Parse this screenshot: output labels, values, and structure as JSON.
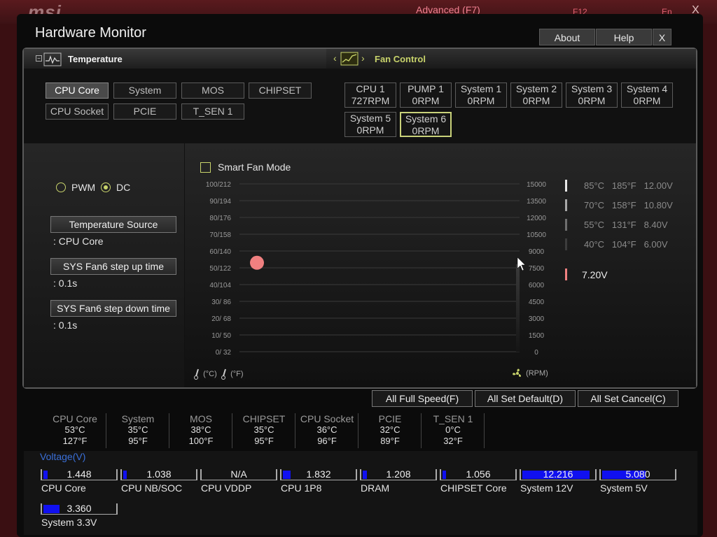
{
  "background": {
    "advanced_label": "Advanced (F7)",
    "f12_label": "F12",
    "lang_label": "En",
    "close": "X",
    "logo_text": "msi"
  },
  "window": {
    "title": "Hardware Monitor",
    "about": "About",
    "help": "Help",
    "close": "X"
  },
  "tabs": {
    "temperature": "Temperature",
    "fan_control": "Fan Control"
  },
  "temp_sources": [
    "CPU Core",
    "System",
    "MOS",
    "CHIPSET",
    "CPU Socket",
    "PCIE",
    "T_SEN 1"
  ],
  "fans": [
    {
      "name": "CPU 1",
      "rpm": "727RPM"
    },
    {
      "name": "PUMP 1",
      "rpm": "0RPM"
    },
    {
      "name": "System 1",
      "rpm": "0RPM"
    },
    {
      "name": "System 2",
      "rpm": "0RPM"
    },
    {
      "name": "System 3",
      "rpm": "0RPM"
    },
    {
      "name": "System 4",
      "rpm": "0RPM"
    },
    {
      "name": "System 5",
      "rpm": "0RPM"
    },
    {
      "name": "System 6",
      "rpm": "0RPM"
    }
  ],
  "selected_fan": "System 6",
  "mode": {
    "pwm": "PWM",
    "dc": "DC",
    "selected": "DC"
  },
  "settings": {
    "temp_source_label": "Temperature Source",
    "temp_source_value": ": CPU Core",
    "step_up_label": "SYS Fan6 step up time",
    "step_up_value": ": 0.1s",
    "step_down_label": "SYS Fan6 step down time",
    "step_down_value": ": 0.1s"
  },
  "smart_fan_label": "Smart Fan Mode",
  "chart_data": {
    "type": "line",
    "y_left_labels": [
      "100/212",
      "90/194",
      "80/176",
      "70/158",
      "60/140",
      "50/122",
      "40/104",
      "30/ 86",
      "20/ 68",
      "10/ 50",
      "0/ 32"
    ],
    "y_right_labels": [
      "15000",
      "13500",
      "12000",
      "10500",
      "9000",
      "7500",
      "6000",
      "4500",
      "3000",
      "1500",
      "0"
    ],
    "x_unit_c": "(°C)",
    "x_unit_f": "(°F)",
    "rpm_unit": "(RPM)",
    "current_point": {
      "temp_c": 53,
      "temp_f": 127
    },
    "current_rpm": 0
  },
  "legend": [
    {
      "c": "85°C",
      "f": "185°F",
      "v": "12.00V",
      "color": "#e8e8e8"
    },
    {
      "c": "70°C",
      "f": "158°F",
      "v": "10.80V",
      "color": "#a8a8a8"
    },
    {
      "c": "55°C",
      "f": "131°F",
      "v": "8.40V",
      "color": "#6e6e6e"
    },
    {
      "c": "40°C",
      "f": "104°F",
      "v": "6.00V",
      "color": "#3c3c3c"
    }
  ],
  "current_voltage": {
    "value": "7.20V",
    "color": "#f08080"
  },
  "bottom_buttons": {
    "full_speed": "All Full Speed(F)",
    "set_default": "All Set Default(D)",
    "set_cancel": "All Set Cancel(C)"
  },
  "temperatures": [
    {
      "name": "CPU Core",
      "c": "53°C",
      "f": "127°F"
    },
    {
      "name": "System",
      "c": "35°C",
      "f": "95°F"
    },
    {
      "name": "MOS",
      "c": "38°C",
      "f": "100°F"
    },
    {
      "name": "CHIPSET",
      "c": "35°C",
      "f": "95°F"
    },
    {
      "name": "CPU Socket",
      "c": "36°C",
      "f": "96°F"
    },
    {
      "name": "PCIE",
      "c": "32°C",
      "f": "89°F"
    },
    {
      "name": "T_SEN 1",
      "c": "0°C",
      "f": "32°F"
    }
  ],
  "voltage_title": "Voltage(V)",
  "voltages": [
    {
      "name": "CPU Core",
      "value": "1.448",
      "level": 0.06
    },
    {
      "name": "CPU NB/SOC",
      "value": "1.038",
      "level": 0.05
    },
    {
      "name": "CPU VDDP",
      "value": "N/A",
      "level": 0
    },
    {
      "name": "CPU 1P8",
      "value": "1.832",
      "level": 0.11
    },
    {
      "name": "DRAM",
      "value": "1.208",
      "level": 0.06
    },
    {
      "name": "CHIPSET Core",
      "value": "1.056",
      "level": 0.05
    },
    {
      "name": "System 12V",
      "value": "12.216",
      "level": 0.92
    },
    {
      "name": "System 5V",
      "value": "5.080",
      "level": 0.6
    },
    {
      "name": "System 3.3V",
      "value": "3.360",
      "level": 0.22
    }
  ]
}
